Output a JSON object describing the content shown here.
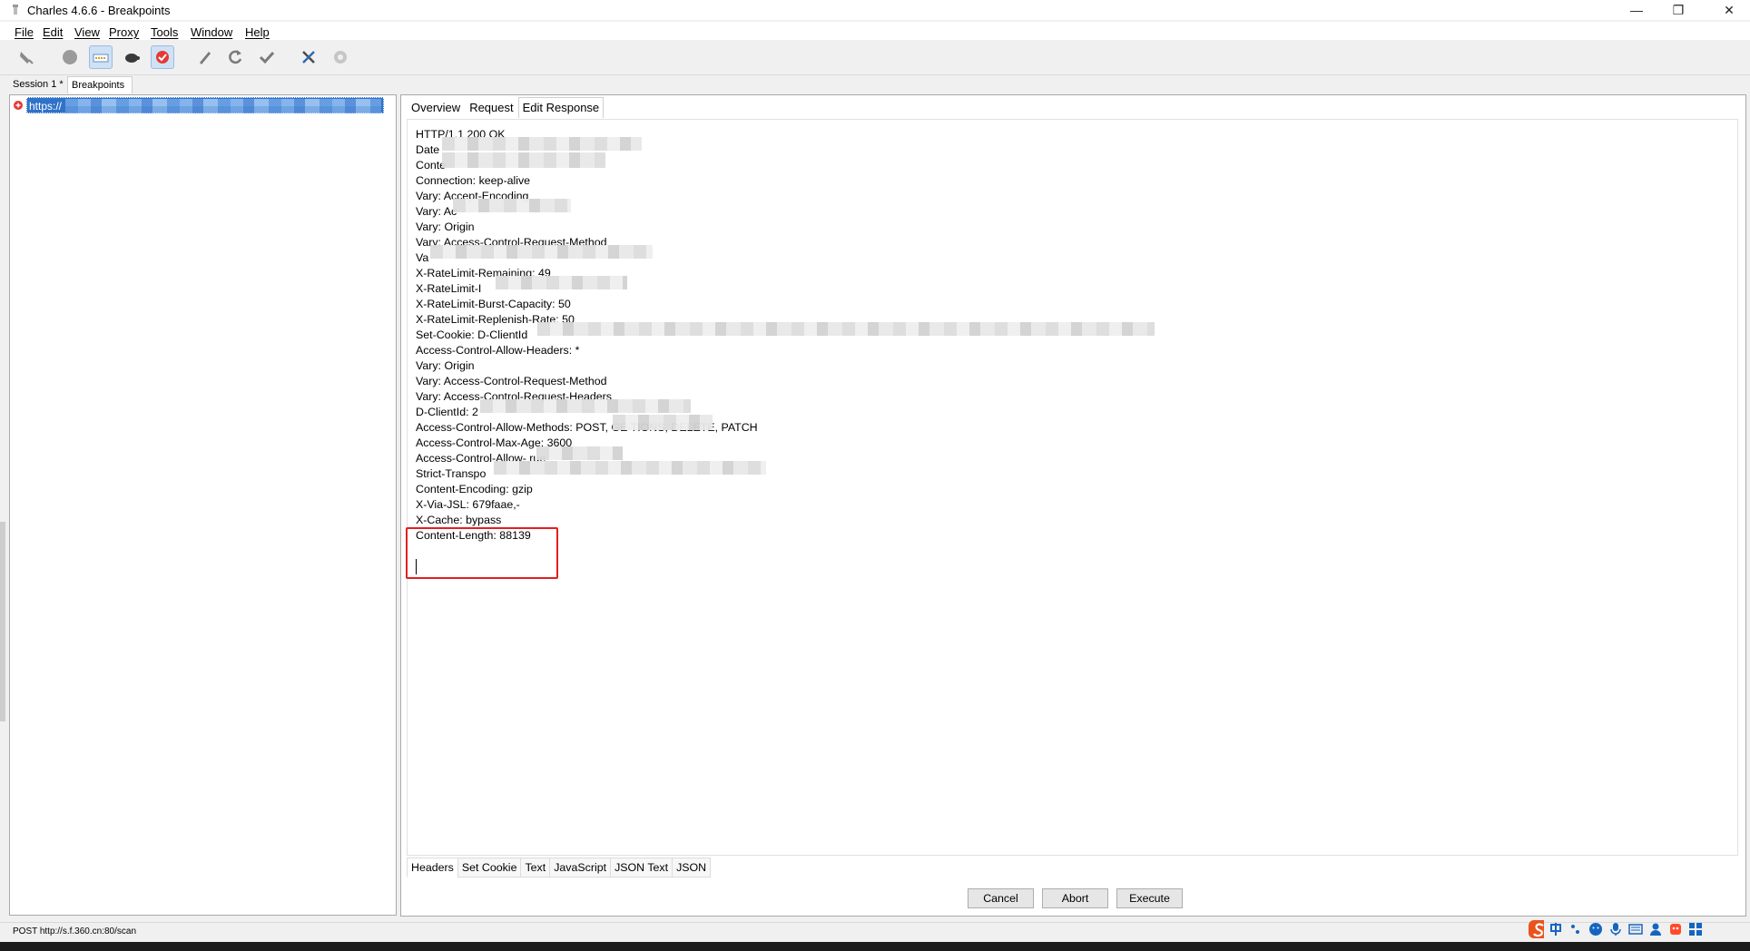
{
  "window": {
    "title": "Charles 4.6.6 - Breakpoints",
    "controls": [
      "minimize",
      "restore",
      "close"
    ]
  },
  "menu": [
    "File",
    "Edit",
    "View",
    "Proxy",
    "Tools",
    "Window",
    "Help"
  ],
  "toolbar": {
    "buttons": [
      "broom-icon",
      "record-icon",
      "throttle-icon",
      "turtle-icon",
      "breakpoint-icon",
      "pen-icon",
      "refresh-icon",
      "check-icon",
      "tools-icon",
      "settings-icon"
    ]
  },
  "session_tabs": [
    "Session 1 *",
    "Breakpoints"
  ],
  "left": {
    "selected_url": "https://"
  },
  "top_tabs": [
    "Overview",
    "Request",
    "Edit Response"
  ],
  "headers": [
    "HTTP/1.1 200 OK",
    "Date",
    "Conte",
    "Connection: keep-alive",
    "Vary: Accept-Encoding",
    "Vary: Ac",
    "Vary: Origin",
    "Vary: Access-Control-Request-Method",
    "Va",
    "X-RateLimit-Remaining: 49",
    "X-RateLimit-I",
    "X-RateLimit-Burst-Capacity: 50",
    "X-RateLimit-Replenish-Rate: 50",
    "Set-Cookie: D-ClientId",
    "Access-Control-Allow-Headers: *",
    "Vary: Origin",
    "Vary: Access-Control-Request-Method",
    "Vary: Access-Control-Request-Headers",
    "D-ClientId: 2",
    "Access-Control-Allow-Methods: POST, GE                TIONS, DELETE, PATCH",
    "Access-Control-Max-Age: 3600",
    "Access-Control-Allow-         rue",
    "Strict-Transpo",
    "Content-Encoding: gzip",
    "X-Via-JSL: 679faae,-",
    "X-Cache: bypass",
    "Content-Length: 88139"
  ],
  "bottom_tabs": [
    "Headers",
    "Set Cookie",
    "Text",
    "JavaScript",
    "JSON Text",
    "JSON"
  ],
  "actions": {
    "cancel": "Cancel",
    "abort": "Abort",
    "execute": "Execute"
  },
  "status": "POST http://s.f.360.cn:80/scan",
  "colors": {
    "selection": "#2f72c8",
    "highlight_box": "#e02020"
  }
}
